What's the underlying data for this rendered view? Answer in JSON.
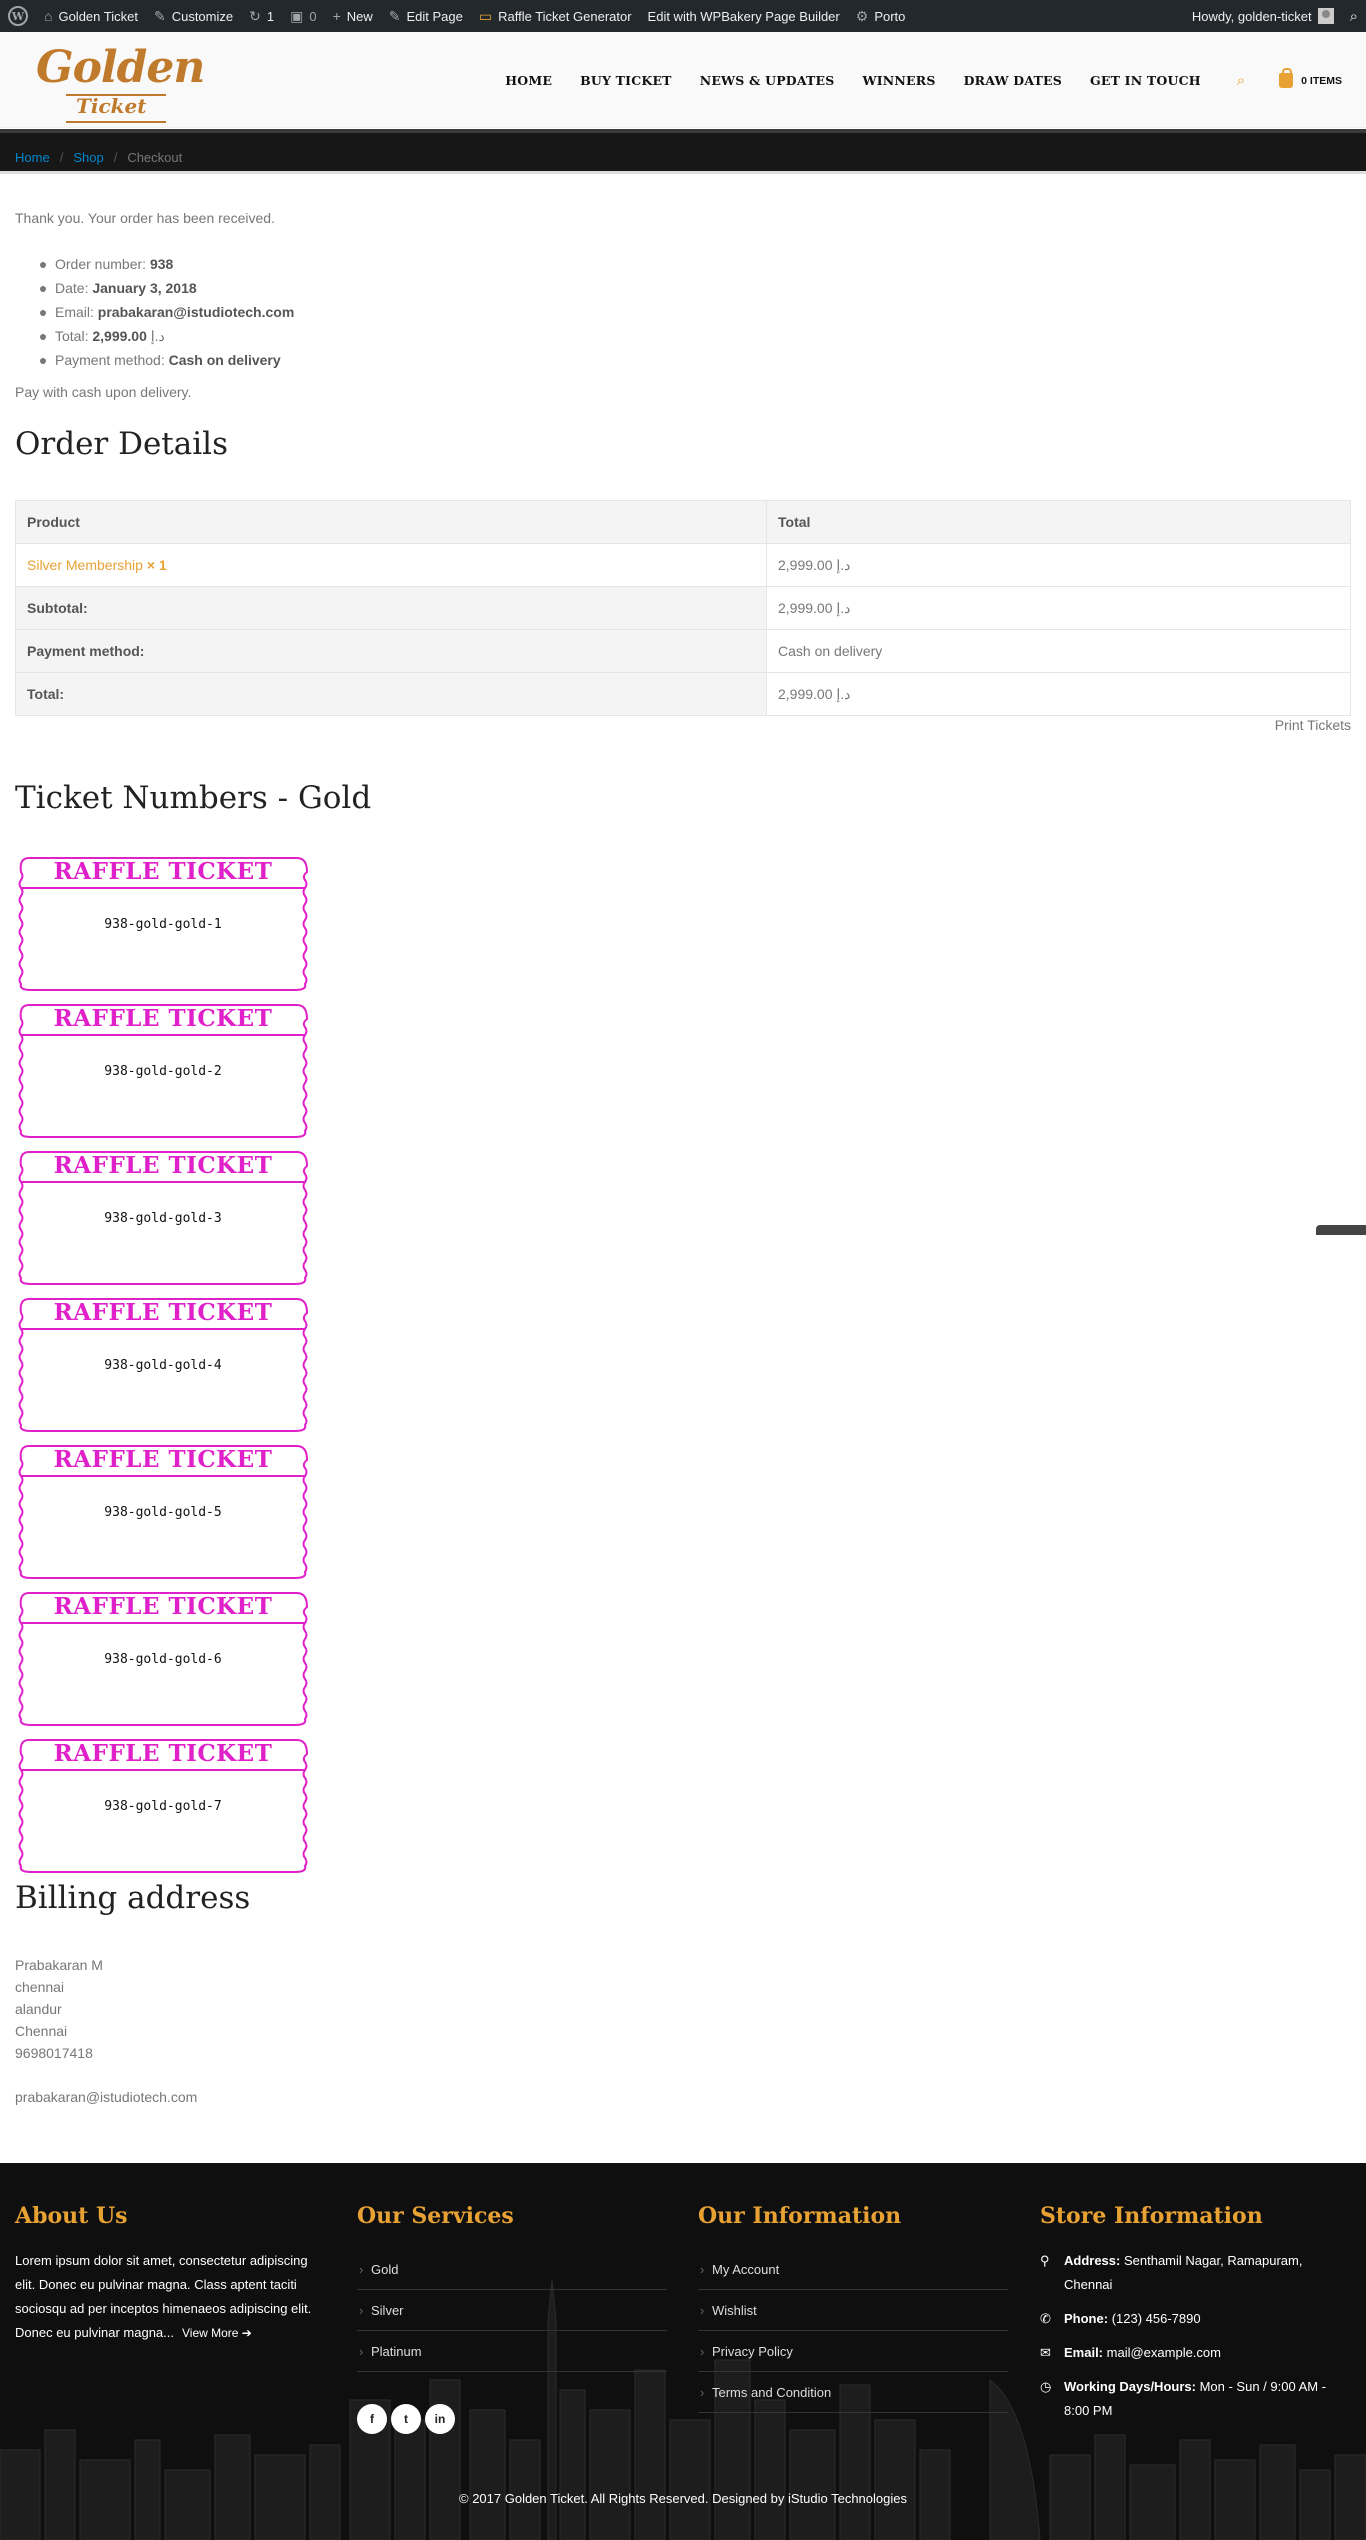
{
  "adminbar": {
    "site_name": "Golden Ticket",
    "customize": "Customize",
    "updates_count": "1",
    "comments_count": "0",
    "new_label": "New",
    "edit_page": "Edit Page",
    "raffle": "Raffle Ticket Generator",
    "wpbakery": "Edit with WPBakery Page Builder",
    "porto": "Porto",
    "howdy": "Howdy, golden-ticket"
  },
  "logo": {
    "line1": "Golden",
    "line2": "Ticket"
  },
  "nav": {
    "items": [
      "HOME",
      "BUY TICKET",
      "NEWS & UPDATES",
      "WINNERS",
      "DRAW DATES",
      "GET IN TOUCH"
    ],
    "cart_label": "0 ITEMS"
  },
  "breadcrumb": {
    "home": "Home",
    "shop": "Shop",
    "current": "Checkout",
    "sep": "/"
  },
  "order": {
    "thanks": "Thank you. Your order has been received.",
    "overview": [
      {
        "label": "Order number:",
        "value": "938"
      },
      {
        "label": "Date:",
        "value": "January 3, 2018"
      },
      {
        "label": "Email:",
        "value": "prabakaran@istudiotech.com"
      },
      {
        "label": "Total:",
        "value": "2,999.00",
        "suffix": "د.إ"
      },
      {
        "label": "Payment method:",
        "value": "Cash on delivery"
      }
    ],
    "pay_note": "Pay with cash upon delivery.",
    "details_heading": "Order Details",
    "table": {
      "headers": [
        "Product",
        "Total"
      ],
      "product_name": "Silver Membership",
      "product_qty": "× 1",
      "product_total": "2,999.00 د.إ",
      "rows": [
        {
          "label": "Subtotal:",
          "value": "2,999.00 د.إ"
        },
        {
          "label": "Payment method:",
          "value": "Cash on delivery"
        },
        {
          "label": "Total:",
          "value": "2,999.00 د.إ"
        }
      ]
    },
    "print_tickets": "Print Tickets"
  },
  "tickets": {
    "heading": "Ticket Numbers - Gold",
    "title": "RAFFLE TICKET",
    "numbers": [
      "938-gold-gold-1",
      "938-gold-gold-2",
      "938-gold-gold-3",
      "938-gold-gold-4",
      "938-gold-gold-5",
      "938-gold-gold-6",
      "938-gold-gold-7"
    ],
    "color": "#e020c8"
  },
  "billing": {
    "heading": "Billing address",
    "lines": [
      "Prabakaran M",
      "chennai",
      "alandur",
      "Chennai",
      "9698017418"
    ],
    "email": "prabakaran@istudiotech.com"
  },
  "footer": {
    "about_heading": "About Us",
    "about_text": "Lorem ipsum dolor sit amet, consectetur adipiscing elit. Donec eu pulvinar magna. Class aptent taciti sociosqu ad per inceptos himenaeos adipiscing elit. Donec eu pulvinar magna...",
    "view_more": "View More",
    "services_heading": "Our Services",
    "services": [
      "Gold",
      "Silver",
      "Platinum"
    ],
    "social": [
      "f",
      "t",
      "in"
    ],
    "info_heading": "Our Information",
    "info": [
      "My Account",
      "Wishlist",
      "Privacy Policy",
      "Terms and Condition"
    ],
    "store_heading": "Store Information",
    "store": [
      {
        "label": "Address:",
        "value": "Senthamil Nagar, Ramapuram, Chennai",
        "icon": "map-marker-icon"
      },
      {
        "label": "Phone:",
        "value": "(123) 456-7890",
        "icon": "phone-icon"
      },
      {
        "label": "Email:",
        "value": "mail@example.com",
        "icon": "envelope-icon"
      },
      {
        "label": "Working Days/Hours:",
        "value": "Mon - Sun / 9:00 AM - 8:00 PM",
        "icon": "clock-icon"
      }
    ],
    "copyright": "© 2017 Golden Ticket. All Rights Reserved. Designed by iStudio Technologies"
  },
  "colors": {
    "accent": "#e8a234",
    "link": "#0088cc",
    "ticket": "#e020c8",
    "footer_bg": "#0f0f0f"
  }
}
